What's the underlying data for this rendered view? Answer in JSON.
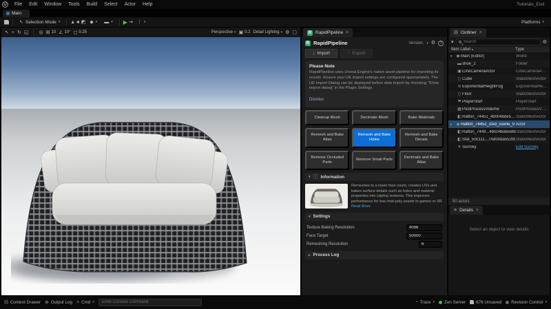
{
  "colors": {
    "accent": "#0b6fd6",
    "selection": "#2a4a6b",
    "play_green": "#58c24a",
    "link": "#4fa3e3",
    "brand_green": "#2fae6f"
  },
  "titlebar": {
    "menu": [
      "File",
      "Edit",
      "Window",
      "Tools",
      "Build",
      "Select",
      "Actor",
      "Help"
    ],
    "project": "Tutorials_End",
    "level_tab": "Main"
  },
  "toolbar": {
    "selection_mode": "Selection Mode",
    "platforms": "Platforms"
  },
  "viewport": {
    "grid_snap": "10",
    "rotation_snap": "10°",
    "scale_snap": "0.25",
    "camera_speed": "0.2",
    "perspective": "Perspective",
    "view_mode": "Detail Lighting"
  },
  "rapid": {
    "tab": "RapidPipeline",
    "brand": "RapidPipeline",
    "version_label": "Version:",
    "import_label": "Import",
    "export_label": "Export",
    "note_title": "Please Note",
    "note_body": "RapidPipeline uses Unreal Engine's native asset pipeline for importing its results. Ensure your UE import settings are configured appropriately. The UE Import Dialog can be displayed before data import by checking \"Show import dialog\" in the Plugin Settings.",
    "dismiss": "Dismiss",
    "actions": [
      {
        "label": "Cleanup Mesh"
      },
      {
        "label": "Decimate Mesh"
      },
      {
        "label": "Bake Materials"
      },
      {
        "label": "Remesh and Bake Atlas"
      },
      {
        "label": "Remesh and Bake Holes"
      },
      {
        "label": "Remesh and Bake Decals"
      },
      {
        "label": "Remove Occluded Parts"
      },
      {
        "label": "Remove Small Parts"
      },
      {
        "label": "Decimate and Bake Atlas"
      }
    ],
    "info_header": "Information",
    "info_text": "Remeshes to a lower face count, creates UVs and bakes surface details such as holes and material properties into (alpha) textures. This improves performance for low-/mid-poly assets in games or XR",
    "read_more": "Read More",
    "settings_header": "Settings",
    "settings": [
      {
        "label": "Texture Baking Resolution",
        "value": "4096"
      },
      {
        "label": "Face Target",
        "value": "50000"
      },
      {
        "label": "Remeshing Resolution",
        "value": "6"
      }
    ],
    "process_log_header": "Process Log"
  },
  "outliner": {
    "tab": "Outliner",
    "search_placeholder": "Search",
    "col_label": "Item Label",
    "col_type": "Type",
    "rows": [
      {
        "label": "Main (Editor)",
        "type": "World"
      },
      {
        "label": "shoe_2",
        "type": "Folder"
      },
      {
        "label": "CineCameraActor",
        "type": "CineCameraActor"
      },
      {
        "label": "Cube",
        "type": "StaticMeshActor"
      },
      {
        "label": "ExponentialHeightFog",
        "type": "ExponentialHeightFog"
      },
      {
        "label": "Floor",
        "type": "StaticMeshActor"
      },
      {
        "label": "PlayerStart",
        "type": "PlayerStart"
      },
      {
        "label": "PostProcessVolume",
        "type": "PostProcessVolume"
      },
      {
        "label": "Ratton_74451_4b004bde55fb",
        "type": "StaticMeshActor"
      },
      {
        "label": "Ratton_74451_ized_scene_0",
        "type": "Actor"
      },
      {
        "label": "Ratton_7449...4b004bde56fb",
        "type": "StaticMeshActor"
      },
      {
        "label": "Stat_50c111...7A800da552fd",
        "type": "StaticMeshActor"
      },
      {
        "label": "SunSky",
        "type": "Edit SunSky"
      }
    ],
    "footer": "50 actors"
  },
  "details": {
    "tab": "Details",
    "empty": "Select an object to view details"
  },
  "statusbar": {
    "content_drawer": "Content Drawer",
    "output_log": "Output Log",
    "cmd": "Cmd",
    "console_placeholder": "Enter Console Command",
    "trace": "Trace",
    "zen": "Zen Server",
    "unsaved": "676 Unsaved",
    "revision": "Revision Control"
  }
}
